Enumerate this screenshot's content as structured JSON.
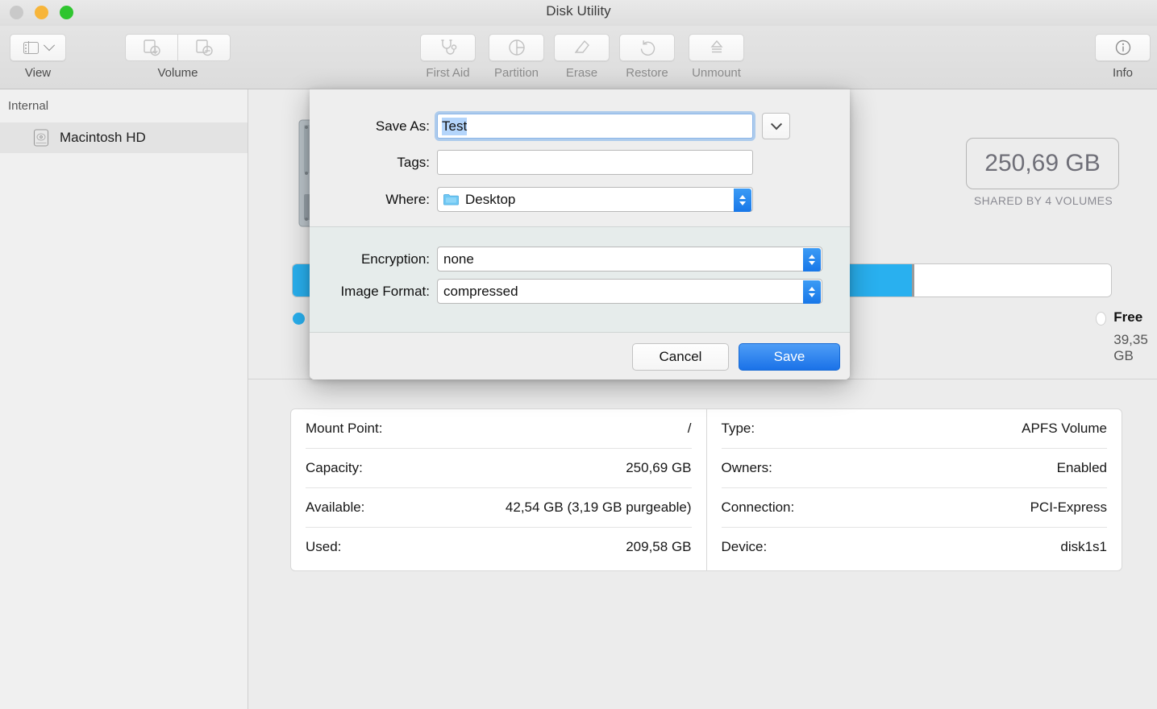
{
  "window": {
    "title": "Disk Utility",
    "traffic_lights": [
      "close",
      "minimize",
      "zoom"
    ]
  },
  "toolbar": {
    "view": {
      "label": "View",
      "icon": "sidebar-icon",
      "chevron": "chevron-down-icon"
    },
    "volume": {
      "label": "Volume",
      "add_icon": "add-volume-icon",
      "remove_icon": "remove-volume-icon"
    },
    "items": [
      {
        "label": "First Aid",
        "icon": "stethoscope-icon",
        "enabled": false
      },
      {
        "label": "Partition",
        "icon": "pie-chart-icon",
        "enabled": false
      },
      {
        "label": "Erase",
        "icon": "erase-icon",
        "enabled": false
      },
      {
        "label": "Restore",
        "icon": "undo-arrow-icon",
        "enabled": false
      },
      {
        "label": "Unmount",
        "icon": "eject-icon",
        "enabled": false
      }
    ],
    "info": {
      "label": "Info",
      "icon": "info-circle-icon"
    }
  },
  "sidebar": {
    "header": "Internal",
    "items": [
      {
        "label": "Macintosh HD",
        "icon": "hard-drive-icon",
        "selected": true
      }
    ]
  },
  "main": {
    "capacity_badge": "250,69 GB",
    "capacity_subtitle": "SHARED BY 4 VOLUMES",
    "legend_free": {
      "name": "Free",
      "size": "39,35 GB",
      "color": "#ffffff"
    },
    "used_color": "#29b0ef",
    "used_percent": 76,
    "info_left": [
      {
        "key": "Mount Point:",
        "value": "/"
      },
      {
        "key": "Capacity:",
        "value": "250,69 GB"
      },
      {
        "key": "Available:",
        "value": "42,54 GB (3,19 GB purgeable)"
      },
      {
        "key": "Used:",
        "value": "209,58 GB"
      }
    ],
    "info_right": [
      {
        "key": "Type:",
        "value": "APFS Volume"
      },
      {
        "key": "Owners:",
        "value": "Enabled"
      },
      {
        "key": "Connection:",
        "value": "PCI-Express"
      },
      {
        "key": "Device:",
        "value": "disk1s1"
      }
    ]
  },
  "dialog": {
    "save_as_label": "Save As:",
    "save_as_value": "Test",
    "expand_icon": "chevron-down-icon",
    "tags_label": "Tags:",
    "tags_value": "",
    "tags_placeholder": "",
    "where_label": "Where:",
    "where_value": "Desktop",
    "where_icon": "folder-icon",
    "encryption_label": "Encryption:",
    "encryption_value": "none",
    "image_format_label": "Image Format:",
    "image_format_value": "compressed",
    "cancel_label": "Cancel",
    "save_label": "Save",
    "accent_color": "#1a72e8"
  }
}
